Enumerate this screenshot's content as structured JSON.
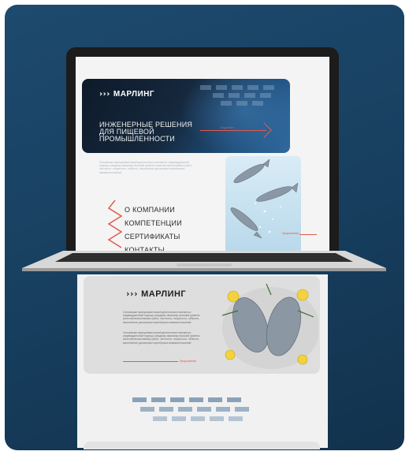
{
  "brand": {
    "logo_text": "МАРЛИНГ",
    "logo_mark": "›››"
  },
  "hero": {
    "title_lines": [
      "ИНЖЕНЕРНЫЕ РЕШЕНИЯ",
      "ДЛЯ ПИЩЕВОЙ",
      "ПРОМЫШЛЕННОСТИ"
    ],
    "arrow_caption": "Подробнее",
    "description": "Основными принципами нашей деятельности являются: индивидуальный подход к каждому заказчику, высокий уровень качества выполняемых работ, честность, открытость, гибкость, выполнение договорных партнёрских взаимоотношений"
  },
  "menu": {
    "items": [
      "О КОМПАНИИ",
      "КОМПЕТЕНЦИИ",
      "СЕРТИФИКАТЫ",
      "КОНТАКТЫ"
    ]
  },
  "photo_caption": "Предложение",
  "page_section": {
    "paragraph_1": "Основными принципами нашей деятельности являются: индивидуальный подход к каждому заказчику, высокий уровень качества выполняемых работ, честность, открытость, гибкость, выполнение договорных партнёрских взаимоотношений",
    "paragraph_2": "Основными принципами нашей деятельности являются: индивидуальный подход к каждому заказчику, высокий уровень качества выполняемых работ, честность, открытость, гибкость, выполнение договорных партнёрских взаимоотношений",
    "link_caption": "Предложение"
  },
  "colors": {
    "accent": "#e05a4e",
    "background": "#1d4a6e",
    "hero_dark": "#0e1a2a"
  }
}
